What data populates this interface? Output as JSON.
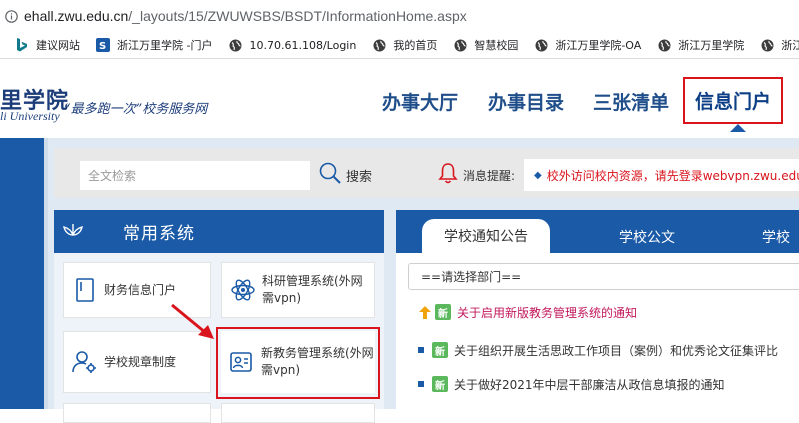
{
  "browser": {
    "url_host": "ehall.zwu.edu.cn",
    "url_path": "/_layouts/15/ZWUWSBS/BSDT/InformationHome.aspx",
    "bookmarks": [
      {
        "label": "建议网站",
        "icon": "bing-icon"
      },
      {
        "label": "浙江万里学院 -门户",
        "icon": "site-s-icon"
      },
      {
        "label": "10.70.61.108/Login",
        "icon": "globe-icon"
      },
      {
        "label": "我的首页",
        "icon": "globe-icon"
      },
      {
        "label": "智慧校园",
        "icon": "globe-icon"
      },
      {
        "label": "浙江万里学院-OA",
        "icon": "globe-icon"
      },
      {
        "label": "浙江万里学院",
        "icon": "globe-icon"
      },
      {
        "label": "浙江万",
        "icon": "globe-icon"
      }
    ]
  },
  "header": {
    "logo_cn": "里学院",
    "logo_en": "li University",
    "slogan": "“最多跑一次”校务服务网",
    "nav": [
      "办事大厅",
      "办事目录",
      "三张清单",
      "信息门户"
    ],
    "active_nav": "信息门户"
  },
  "search": {
    "placeholder": "全文检索",
    "button_label": "搜索",
    "notice_label": "消息提醒:",
    "notice_text": "校外访问校内资源，请先登录webvpn.zwu.edu.cn"
  },
  "systems": {
    "title": "常用系统",
    "cards": [
      {
        "label": "财务信息门户",
        "icon": "document-icon"
      },
      {
        "label": "科研管理系统(外网需vpn)",
        "icon": "atom-icon"
      },
      {
        "label": "学校规章制度",
        "icon": "user-settings-icon"
      },
      {
        "label": "新教务管理系统(外网需vpn)",
        "icon": "id-card-icon"
      }
    ]
  },
  "news": {
    "tabs": [
      "学校通知公告",
      "学校公文",
      "学校"
    ],
    "dept_select": "==请选择部门==",
    "badge": "新",
    "items": [
      {
        "title": "关于启用新版教务管理系统的通知",
        "marker": "arrow-up"
      },
      {
        "title": "关于组织开展生活思政工作项目（案例）和优秀论文征集评比",
        "marker": "square"
      },
      {
        "title": "关于做好2021年中层干部廉洁从政信息填报的通知",
        "marker": "square"
      }
    ]
  },
  "colors": {
    "primary": "#1a5aa6",
    "highlight": "#d9141c",
    "nav_text": "#1f4e8a"
  }
}
